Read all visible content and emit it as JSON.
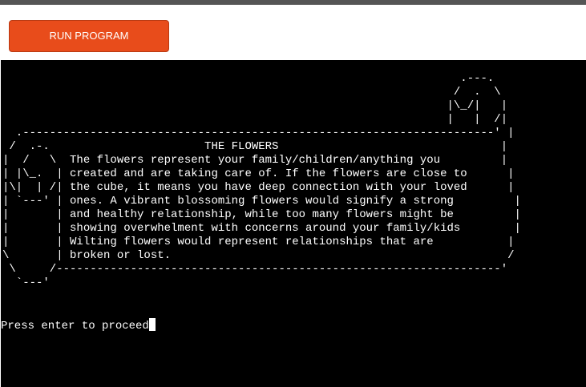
{
  "toolbar": {
    "run_label": "RUN PROGRAM"
  },
  "terminal": {
    "output": "                                                                    .---.\n                                                                   /  .  \\\n                                                                  |\\_/|   |\n                                                                  |   |  /|\n  .----------------------------------------------------------------------' |\n /  .-.                       THE FLOWERS                                 |\n|  /   \\  The flowers represent your family/children/anything you         |\n| |\\_.  | created and are taking care of. If the flowers are close to      |\n|\\|  | /| the cube, it means you have deep connection with your loved      |\n| `---' | ones. A vibrant blossoming flowers would signify a strong         |\n|       | and healthy relationship, while too many flowers might be         |\n|       | showing overwhelment with concerns around your family/kids        |\n|       | Wilting flowers would represent relationships that are           |\n\\       | broken or lost.                                                  /\n \\     /------------------------------------------------------------------'\n  `---'",
    "prompt": "Press enter to proceed"
  },
  "colors": {
    "button": "#e84c1b",
    "terminal_bg": "#000000",
    "terminal_fg": "#ffffff",
    "top_bar": "#555555"
  }
}
